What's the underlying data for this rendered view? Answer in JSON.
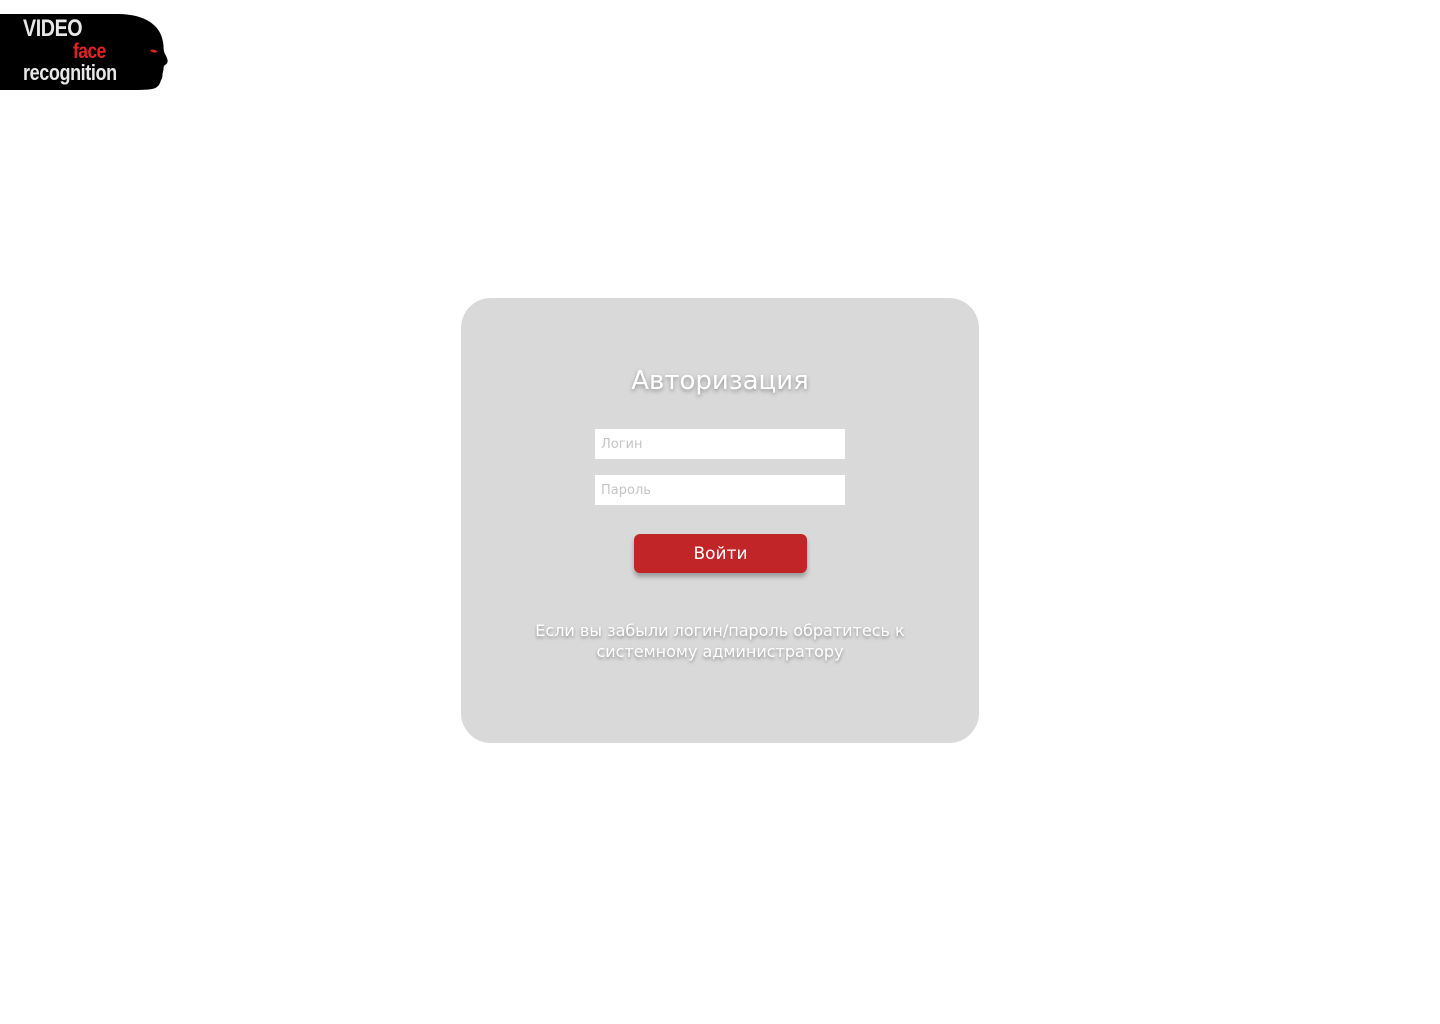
{
  "logo": {
    "line1": "VIDEO",
    "line2": "face",
    "line3": "recognition",
    "colors": {
      "background": "#000000",
      "accent": "#e02424",
      "text": "#e8e8e8"
    }
  },
  "auth": {
    "title": "Авторизация",
    "login_placeholder": "Логин",
    "password_placeholder": "Пароль",
    "submit_label": "Войти",
    "hint": "Если вы забыли логин/пароль обратитесь к системному администратору"
  },
  "colors": {
    "card_background": "#d9d9d9",
    "button": "#c12527"
  }
}
